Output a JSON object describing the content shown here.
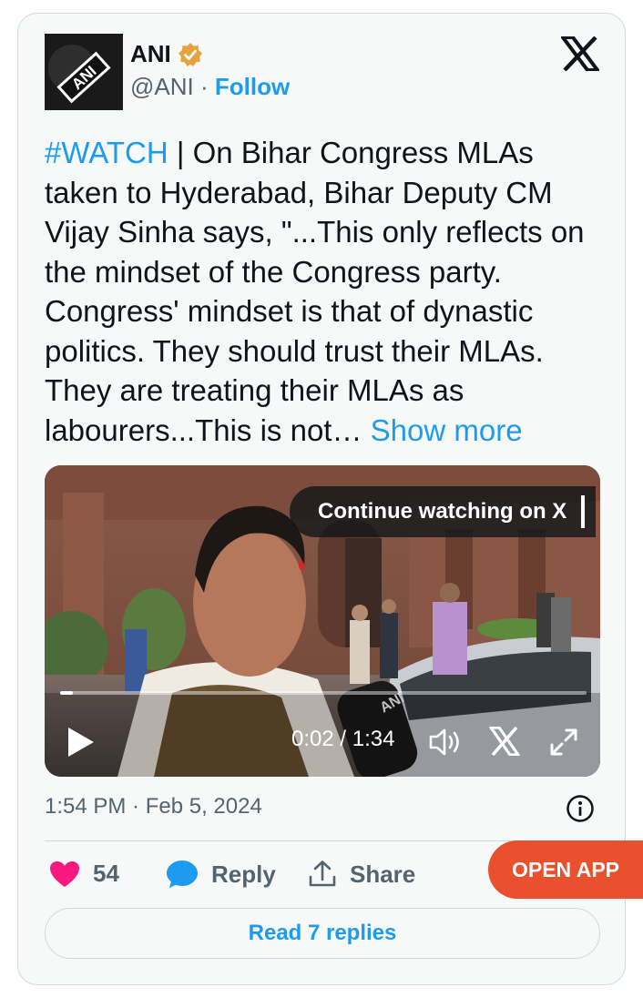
{
  "author": {
    "name": "ANI",
    "handle": "@ANI",
    "separator": "·",
    "follow_label": "Follow",
    "avatar_text": "ANI",
    "verified_color": "#e8a33d"
  },
  "tweet": {
    "hashtag": "#WATCH",
    "body": " | On Bihar Congress MLAs taken to Hyderabad, Bihar Deputy CM Vijay Sinha says, \"...This only reflects on the mindset of the Congress party. Congress' mindset is that of dynastic politics. They should trust their MLAs. They are treating their MLAs as labourers...This is not… ",
    "show_more": "Show more"
  },
  "video": {
    "continue_label": "Continue watching on X",
    "time_display": "0:02 / 1:34",
    "progress_fraction": 0.024,
    "mic_text": "ANI"
  },
  "meta": {
    "timestamp": "1:54 PM · Feb 5, 2024"
  },
  "actions": {
    "likes_count": "54",
    "reply_label": "Reply",
    "share_label": "Share",
    "open_app_label": "OPEN APP",
    "read_replies_label": "Read 7 replies"
  },
  "colors": {
    "accent": "#1d9bf0",
    "like": "#f91880",
    "open_app": "#e8502e"
  },
  "icons": [
    "verified-badge-icon",
    "x-logo-icon",
    "play-icon",
    "volume-icon",
    "x-logo-small-icon",
    "fullscreen-icon",
    "info-icon",
    "heart-icon",
    "reply-bubble-icon",
    "share-icon"
  ]
}
